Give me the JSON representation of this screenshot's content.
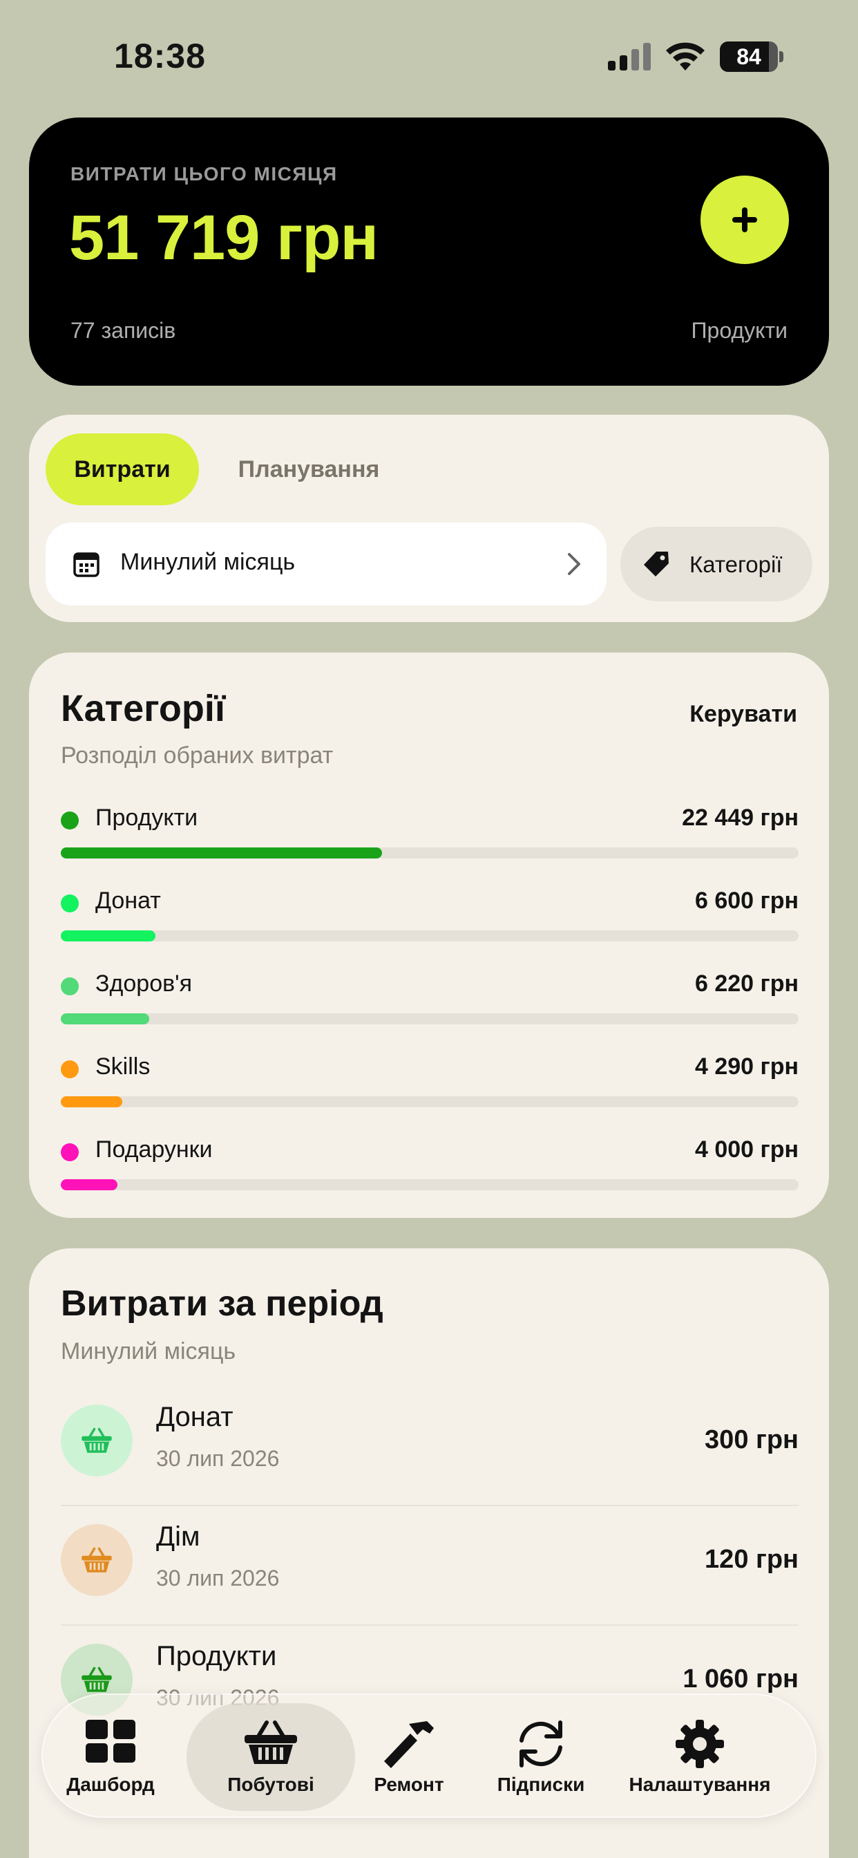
{
  "status_bar": {
    "time": "18:38",
    "battery": "84",
    "battery_level": 0.84
  },
  "hero": {
    "label": "ВИТРАТИ ЦЬОГО МІСЯЦЯ",
    "amount": "51 719 грн",
    "records": "77 записів",
    "category": "Продукти",
    "accent_color": "#d9f03c",
    "add_icon": "plus-icon"
  },
  "tabs": {
    "expenses": "Витрати",
    "planning": "Планування",
    "period": "Минулий місяць",
    "categories": "Категорії"
  },
  "categories_card": {
    "title": "Категорії",
    "manage": "Керувати",
    "subtitle": "Розподіл обраних витрат",
    "items": [
      {
        "name": "Продукти",
        "amount": "22 449 грн",
        "share": 0.435,
        "color": "#1aa319"
      },
      {
        "name": "Донат",
        "amount": "6 600 грн",
        "share": 0.128,
        "color": "#13f25f"
      },
      {
        "name": "Здоров'я",
        "amount": "6 220 грн",
        "share": 0.12,
        "color": "#52d978"
      },
      {
        "name": "Skills",
        "amount": "4 290 грн",
        "share": 0.083,
        "color": "#ff9a10"
      },
      {
        "name": "Подарунки",
        "amount": "4 000 грн",
        "share": 0.077,
        "color": "#ff12b8"
      }
    ]
  },
  "period_card": {
    "title": "Витрати за період",
    "subtitle": "Минулий місяць",
    "transactions": [
      {
        "name": "Донат",
        "date": "30 лип 2026",
        "amount": "300 грн",
        "icon": "basket-icon",
        "icon_color": "#1fbf5a",
        "bg": "#cdf3d5"
      },
      {
        "name": "Дім",
        "date": "30 лип 2026",
        "amount": "120 грн",
        "icon": "basket-icon",
        "icon_color": "#e08a20",
        "bg": "#f3dcc4"
      },
      {
        "name": "Продукти",
        "date": "30 лип 2026",
        "amount": "1 060 грн",
        "icon": "basket-icon",
        "icon_color": "#1a9a19",
        "bg": "#cde5c8"
      }
    ]
  },
  "nav": {
    "items": [
      {
        "label": "Дашборд",
        "icon": "grid-icon"
      },
      {
        "label": "Побутові",
        "icon": "basket-icon"
      },
      {
        "label": "Ремонт",
        "icon": "hammer-icon"
      },
      {
        "label": "Підписки",
        "icon": "refresh-icon"
      },
      {
        "label": "Налаштування",
        "icon": "gear-icon"
      }
    ]
  }
}
